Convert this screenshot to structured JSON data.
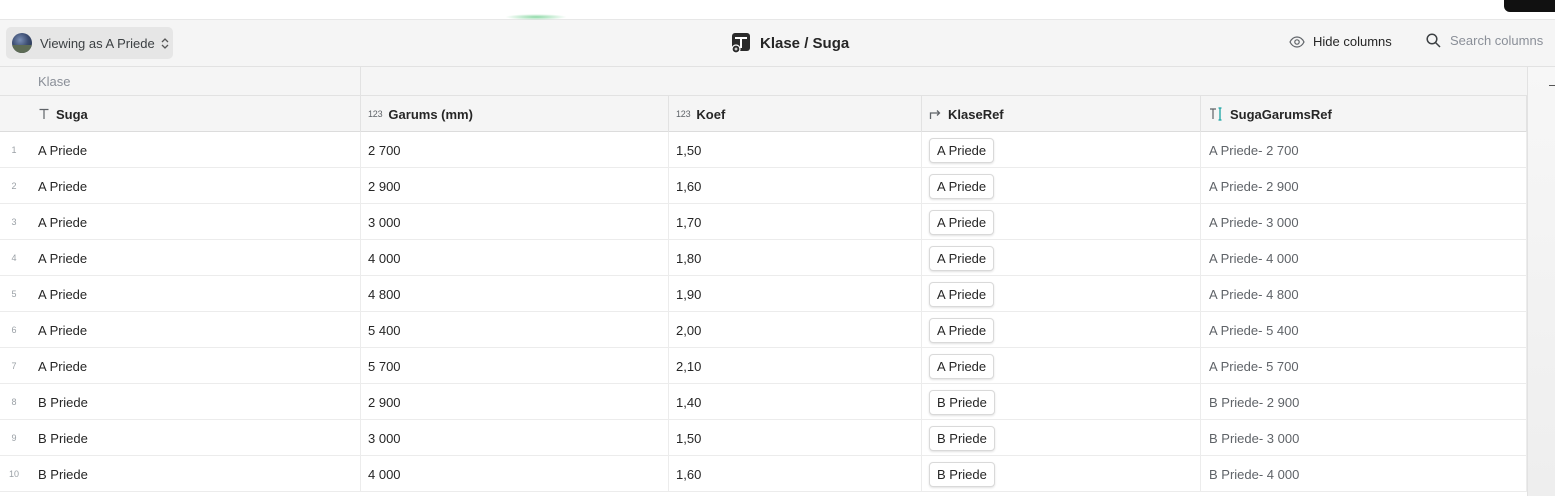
{
  "toolbar": {
    "viewing_label": "Viewing as A Priede",
    "title": "Klase / Suga",
    "hide_columns_label": "Hide columns",
    "search_placeholder": "Search columns"
  },
  "table": {
    "group_header": "Klase",
    "columns": [
      {
        "name": "Suga",
        "type_icon": "T",
        "icon": "text-type-icon"
      },
      {
        "name": "Garums (mm)",
        "type_icon": "123",
        "icon": "number-type-icon"
      },
      {
        "name": "Koef",
        "type_icon": "123",
        "icon": "number-type-icon"
      },
      {
        "name": "KlaseRef",
        "type_icon": "ref",
        "icon": "reference-type-icon"
      },
      {
        "name": "SugaGarumsRef",
        "type_icon": "TI",
        "icon": "formula-text-type-icon"
      }
    ],
    "rows": [
      {
        "num": "1",
        "suga": "A Priede",
        "garums": "2 700",
        "koef": "1,50",
        "klaseref": "A Priede",
        "sugagarumsref": "A Priede- 2 700"
      },
      {
        "num": "2",
        "suga": "A Priede",
        "garums": "2 900",
        "koef": "1,60",
        "klaseref": "A Priede",
        "sugagarumsref": "A Priede- 2 900"
      },
      {
        "num": "3",
        "suga": "A Priede",
        "garums": "3 000",
        "koef": "1,70",
        "klaseref": "A Priede",
        "sugagarumsref": "A Priede- 3 000"
      },
      {
        "num": "4",
        "suga": "A Priede",
        "garums": "4 000",
        "koef": "1,80",
        "klaseref": "A Priede",
        "sugagarumsref": "A Priede- 4 000"
      },
      {
        "num": "5",
        "suga": "A Priede",
        "garums": "4 800",
        "koef": "1,90",
        "klaseref": "A Priede",
        "sugagarumsref": "A Priede- 4 800"
      },
      {
        "num": "6",
        "suga": "A Priede",
        "garums": "5 400",
        "koef": "2,00",
        "klaseref": "A Priede",
        "sugagarumsref": "A Priede- 5 400"
      },
      {
        "num": "7",
        "suga": "A Priede",
        "garums": "5 700",
        "koef": "2,10",
        "klaseref": "A Priede",
        "sugagarumsref": "A Priede- 5 700"
      },
      {
        "num": "8",
        "suga": "B Priede",
        "garums": "2 900",
        "koef": "1,40",
        "klaseref": "B Priede",
        "sugagarumsref": "B Priede- 2 900"
      },
      {
        "num": "9",
        "suga": "B Priede",
        "garums": "3 000",
        "koef": "1,50",
        "klaseref": "B Priede",
        "sugagarumsref": "B Priede- 3 000"
      },
      {
        "num": "10",
        "suga": "B Priede",
        "garums": "4 000",
        "koef": "1,60",
        "klaseref": "B Priede",
        "sugagarumsref": "B Priede- 4 000"
      }
    ]
  },
  "colors": {
    "toolbar_bg": "#f5f5f5",
    "active_tab_accent": "#2eb85c",
    "link_blue": "#1a73e8"
  }
}
